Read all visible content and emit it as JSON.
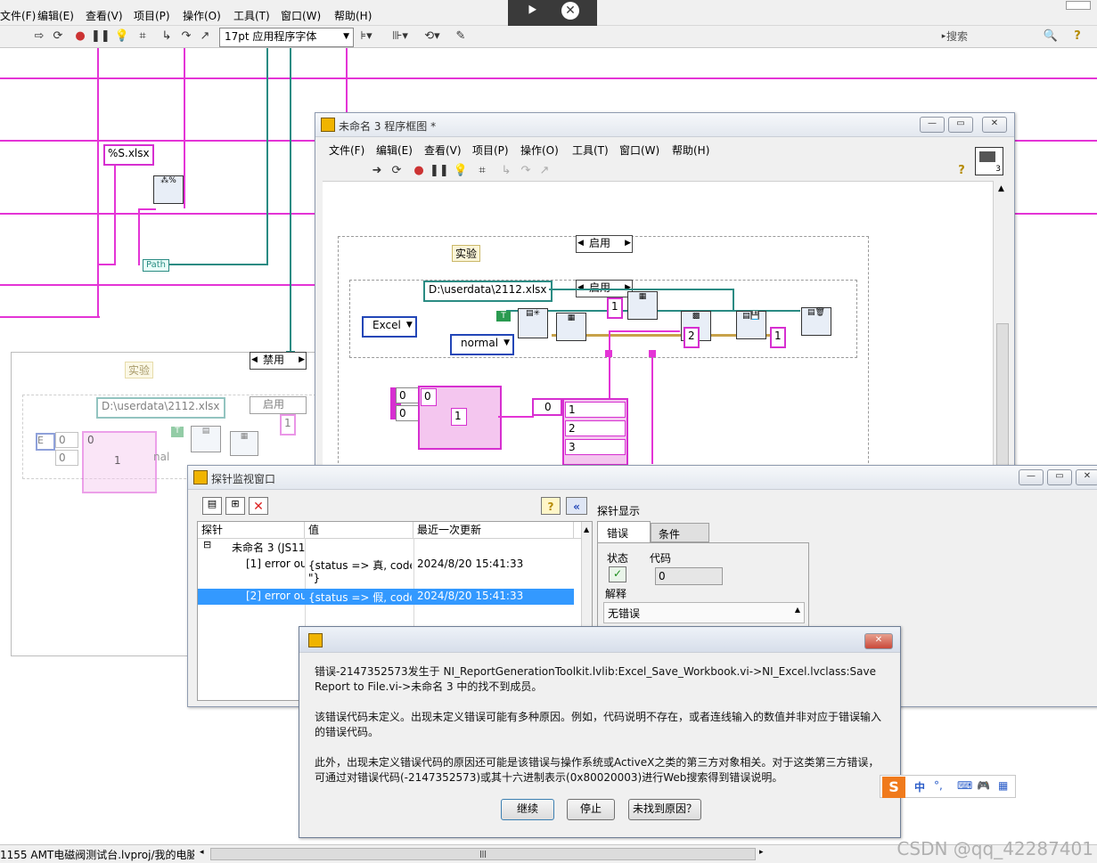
{
  "main": {
    "menu": [
      "文件(F)",
      "编辑(E)",
      "查看(V)",
      "项目(P)",
      "操作(O)",
      "工具(T)",
      "窗口(W)",
      "帮助(H)"
    ],
    "font_select": "17pt 应用程序字体",
    "search_placeholder": "搜索",
    "help_icon": "?",
    "constants": {
      "format": "%S.xlsx",
      "path_label": "Path",
      "disable_case": "禁用",
      "experiment_label": "实验",
      "bg_path": "D:\\userdata\\2112.xlsx",
      "bg_case": "启用",
      "bg_index": "1",
      "bg_ring": "E",
      "bg_ring2": "nal",
      "bg_arr_idx": [
        "0",
        "0"
      ],
      "bg_arr_vals": [
        "0",
        "1"
      ],
      "bg_bool": "T"
    },
    "statusbar": "1155 AMT电磁阀测试台.lvproj/我的电脑",
    "watermark": "CSDN @qq_42287401"
  },
  "diagram": {
    "title": "未命名 3 程序框图 *",
    "menu": [
      "文件(F)",
      "编辑(E)",
      "查看(V)",
      "项目(P)",
      "操作(O)",
      "工具(T)",
      "窗口(W)",
      "帮助(H)"
    ],
    "help_icon": "?",
    "vi_number": "3",
    "outer_case": "启用",
    "experiment_label": "实验",
    "path_const": "D:\\userdata\\2112.xlsx",
    "inner_case": "启用",
    "ring_excel": "Excel",
    "ring_normal": "normal",
    "bool_const": "T",
    "num_consts": [
      "1",
      "2",
      "1"
    ],
    "array_index": [
      "0",
      "0"
    ],
    "array_values": [
      "0",
      "1"
    ],
    "idx_const": "0",
    "build_values": [
      "1",
      "2",
      "3"
    ]
  },
  "probe": {
    "title": "探针监视窗口",
    "columns": [
      "探针",
      "值",
      "最近一次更新"
    ],
    "group": "未命名 3 (JS11",
    "rows": [
      {
        "name": "[1] error ou",
        "value": "{status => 真, code",
        "value2": "\"}",
        "time": "2024/8/20 15:41:33"
      },
      {
        "name": "[2] error ou",
        "value": "{status => 假, code",
        "value2": "",
        "time": "2024/8/20 15:41:33"
      }
    ],
    "display_title": "探针显示",
    "tabs": [
      "错误",
      "条件"
    ],
    "status_label": "状态",
    "code_label": "代码",
    "code_value": "0",
    "source_label": "解释",
    "source_value": "无错误",
    "help_icon": "?",
    "collapse_icon": "«"
  },
  "dialog": {
    "para1_line1": "错误-2147352573发生于 NI_ReportGenerationToolkit.lvlib:Excel_Save_Workbook.vi->NI_Excel.lvclass:Save",
    "para1_line2": "Report to File.vi->未命名 3 中的找不到成员。",
    "para2_line1": "该错误代码未定义。出现未定义错误可能有多种原因。例如，代码说明不存在，或者连线输入的数值并非对应于错误输入",
    "para2_line2": "的错误代码。",
    "para3_line1": "此外，出现未定义错误代码的原因还可能是该错误与操作系统或ActiveX之类的第三方对象相关。对于这类第三方错误，",
    "para3_line2": "可通过对错误代码(-2147352573)或其十六进制表示(0x80020003)进行Web搜索得到错误说明。",
    "buttons": [
      "继续",
      "停止",
      "未找到原因？"
    ]
  },
  "ime": {
    "label": "中",
    "punct": "°,"
  }
}
